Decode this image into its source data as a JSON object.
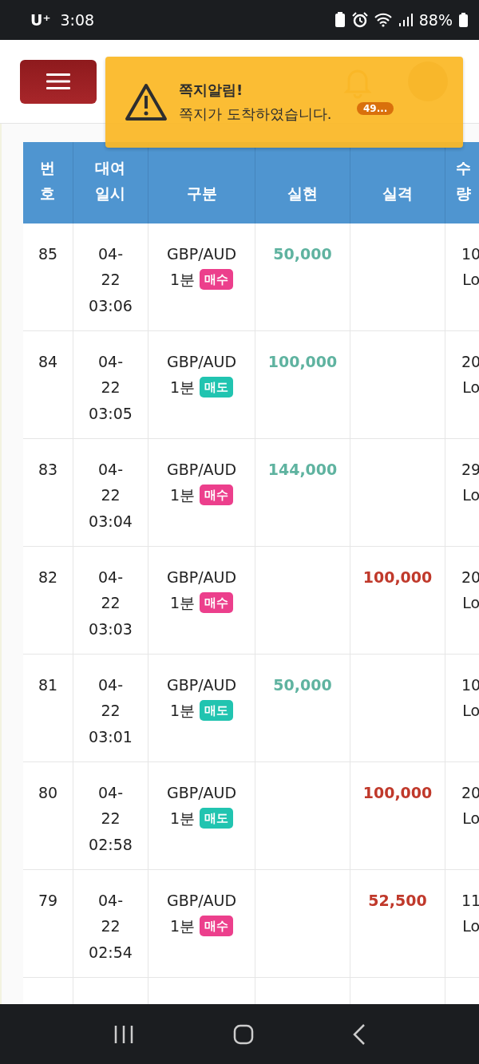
{
  "status_bar": {
    "carrier": "U⁺",
    "time": "3:08",
    "battery": "88%"
  },
  "header": {
    "notification_badge": "49..."
  },
  "toast": {
    "title": "쪽지알림!",
    "message": "쪽지가 도착하였습니다."
  },
  "table": {
    "columns": [
      "번호",
      "대여 일시",
      "구분",
      "실현",
      "실격",
      "수량"
    ],
    "rows": [
      {
        "no": "85",
        "date": "04-22",
        "time": "03:06",
        "pair": "GBP/AUD",
        "interval": "1분",
        "badge": {
          "label": "매수",
          "kind": "buy"
        },
        "realized": "50,000",
        "lost": "",
        "column_6": [
          "10",
          "Lo"
        ]
      },
      {
        "no": "84",
        "date": "04-22",
        "time": "03:05",
        "pair": "GBP/AUD",
        "interval": "1분",
        "badge": {
          "label": "매도",
          "kind": "sell"
        },
        "realized": "100,000",
        "lost": "",
        "column_6": [
          "20",
          "Lo"
        ]
      },
      {
        "no": "83",
        "date": "04-22",
        "time": "03:04",
        "pair": "GBP/AUD",
        "interval": "1분",
        "badge": {
          "label": "매수",
          "kind": "buy"
        },
        "realized": "144,000",
        "lost": "",
        "column_6": [
          "29",
          "Lo"
        ]
      },
      {
        "no": "82",
        "date": "04-22",
        "time": "03:03",
        "pair": "GBP/AUD",
        "interval": "1분",
        "badge": {
          "label": "매수",
          "kind": "buy"
        },
        "realized": "",
        "lost": "100,000",
        "column_6": [
          "20",
          "Lo"
        ]
      },
      {
        "no": "81",
        "date": "04-22",
        "time": "03:01",
        "pair": "GBP/AUD",
        "interval": "1분",
        "badge": {
          "label": "매도",
          "kind": "sell"
        },
        "realized": "50,000",
        "lost": "",
        "column_6": [
          "10",
          "Lo"
        ]
      },
      {
        "no": "80",
        "date": "04-22",
        "time": "02:58",
        "pair": "GBP/AUD",
        "interval": "1분",
        "badge": {
          "label": "매도",
          "kind": "sell"
        },
        "realized": "",
        "lost": "100,000",
        "column_6": [
          "20",
          "Lo"
        ]
      },
      {
        "no": "79",
        "date": "04-22",
        "time": "02:54",
        "pair": "GBP/AUD",
        "interval": "1분",
        "badge": {
          "label": "매수",
          "kind": "buy"
        },
        "realized": "",
        "lost": "52,500",
        "column_6": [
          "11",
          "Lo"
        ]
      }
    ]
  }
}
